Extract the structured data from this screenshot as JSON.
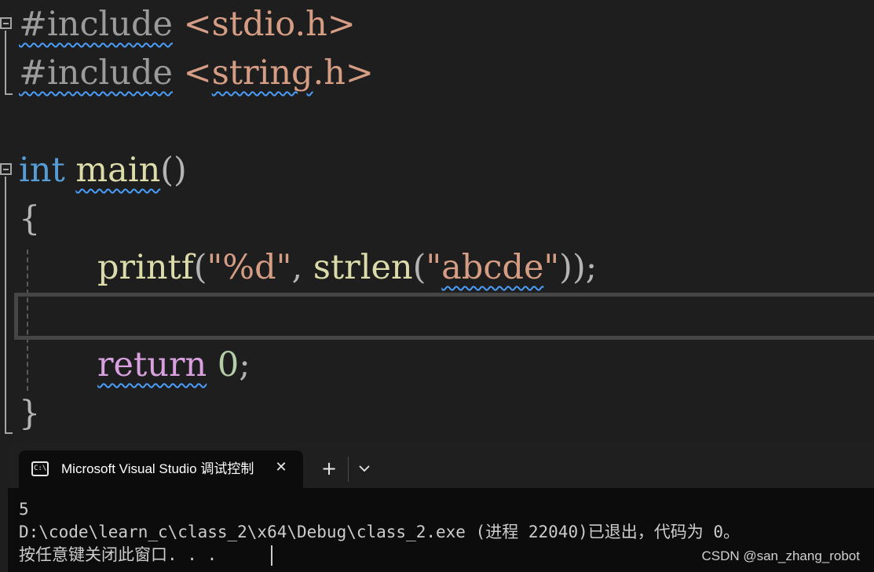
{
  "editor": {
    "line1": {
      "directive": "#include",
      "header": "<stdio.h>"
    },
    "line2": {
      "directive": "#include",
      "header_open": "<",
      "header_name": "string",
      "header_close": ".h>"
    },
    "line4": {
      "type": "int",
      "name": "main",
      "parens": "()"
    },
    "line5": {
      "brace": "{"
    },
    "line6": {
      "fn": "printf",
      "open": "(",
      "fmt": "\"%d\"",
      "comma": ", ",
      "fn2": "strlen",
      "open2": "(",
      "q1": "\"",
      "arg": "abcde",
      "q2": "\"",
      "close": "));"
    },
    "line8": {
      "keyword": "return",
      "value": "0",
      "semi": ";"
    },
    "line9": {
      "brace": "}"
    }
  },
  "terminal": {
    "tab_title": "Microsoft Visual Studio 调试控制台",
    "tab_icon_glyph": "C:\\",
    "close_glyph": "✕",
    "new_tab_glyph": "+",
    "output": [
      "5",
      "D:\\code\\learn_c\\class_2\\x64\\Debug\\class_2.exe (进程 22040)已退出，代码为 0。",
      "按任意键关闭此窗口. . ."
    ]
  },
  "watermark": "CSDN @san_zhang_robot",
  "colors": {
    "keyword": "#569cd6",
    "control_keyword": "#d8a0df",
    "function": "#dcdcaa",
    "string": "#d69d85",
    "number": "#b5cea8",
    "squiggle": "#4a9df8",
    "editor_bg": "#1e1e1e",
    "terminal_bg": "#0c0c0c"
  },
  "icons": [
    "fold-collapse-icon",
    "console-icon",
    "close-icon",
    "plus-icon",
    "chevron-down-icon"
  ]
}
